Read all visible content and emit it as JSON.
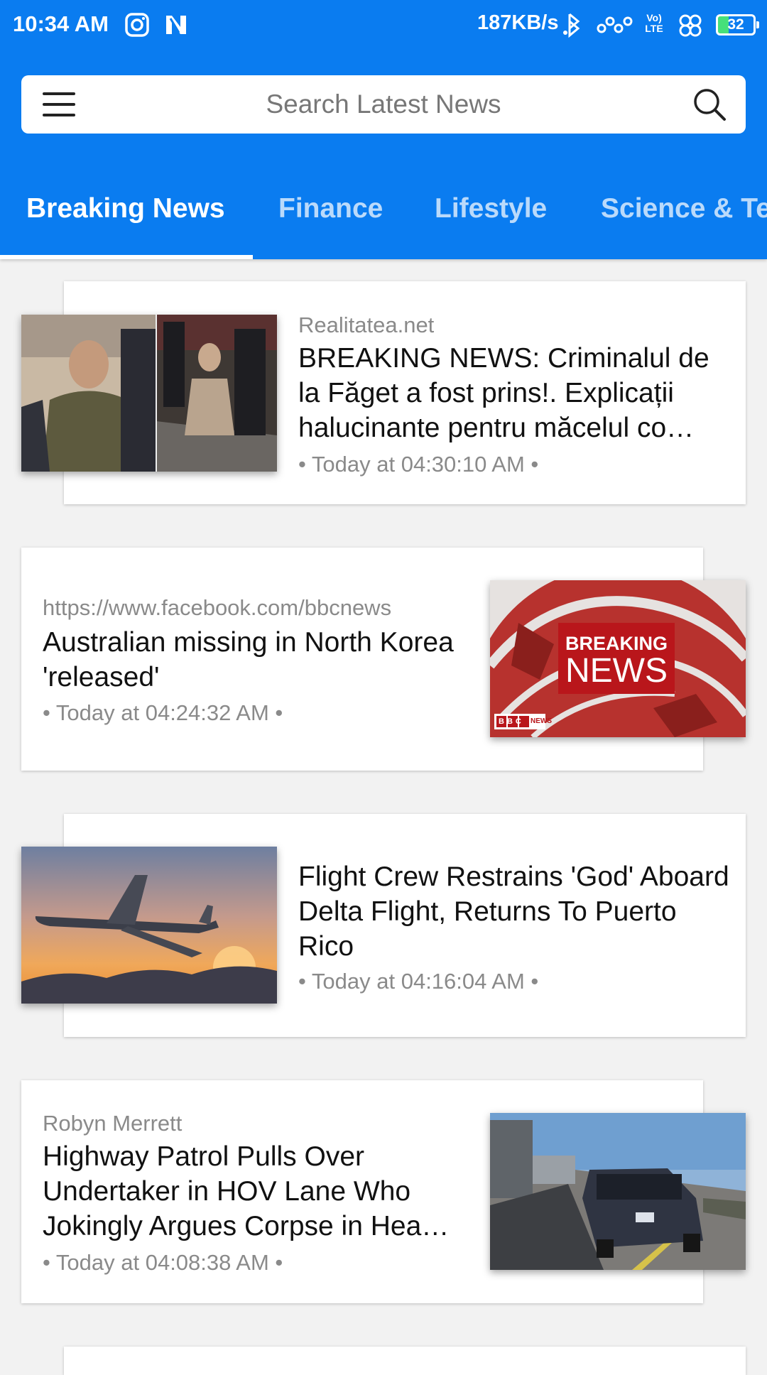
{
  "status_bar": {
    "time": "10:34 AM",
    "speed": "187KB/s",
    "volte": "Vo) LTE",
    "battery": "32",
    "icons": [
      "instagram-icon",
      "n-app-icon",
      "bluetooth-icon",
      "signal-icon",
      "volte-icon",
      "wifi-icon",
      "battery-icon"
    ]
  },
  "search": {
    "placeholder": "Search Latest News",
    "value": ""
  },
  "tabs": [
    "Breaking News",
    "Finance",
    "Lifestyle",
    "Science & Tech"
  ],
  "active_tab": "Breaking News",
  "colors": {
    "accent": "#0a7cf0",
    "background": "#f2f2f2"
  },
  "articles": [
    {
      "source": "Realitatea.net",
      "title": "BREAKING NEWS: Criminalul de la Făget a fost prins!. Explicații halucinante pentru măcelul co…",
      "time": "• Today at 04:30:10 AM •",
      "image": "arrest-photo"
    },
    {
      "source": "https://www.facebook.com/bbcnews",
      "title": "Australian missing in North Korea 'released'",
      "time": "• Today at 04:24:32 AM •",
      "image": "bbc-breaking-news-graphic",
      "image_text": {
        "line1": "BREAKING",
        "line2": "NEWS",
        "logo": "BBC",
        "logo_suffix": "NEWS"
      }
    },
    {
      "source": "",
      "title": "Flight Crew Restrains 'God' Aboard Delta Flight, Returns To Puerto Rico",
      "time": "• Today at 04:16:04 AM •",
      "image": "airplane-sunset-photo"
    },
    {
      "source": "Robyn Merrett",
      "title": "Highway Patrol Pulls Over Undertaker in HOV Lane Who Jokingly Argues Corpse in Hea…",
      "time": "• Today at 04:08:38 AM •",
      "image": "minivan-highway-photo"
    }
  ]
}
